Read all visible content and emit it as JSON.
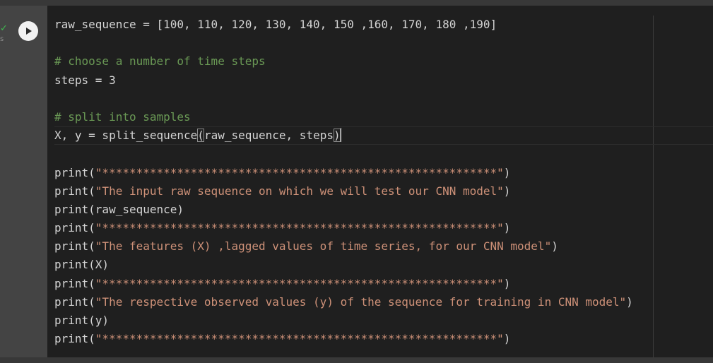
{
  "cell": {
    "run_button_label": "Run cell",
    "status": "✓",
    "status_text": "s"
  },
  "code_lines": [
    "raw_sequence = [100, 110, 120, 130, 140, 150 ,160, 170, 180 ,190]",
    "",
    "# choose a number of time steps",
    "steps = 3",
    "",
    "# split into samples",
    "X, y = split_sequence(raw_sequence, steps)",
    "",
    "print(\"**********************************************************\")",
    "print(\"The input raw sequence on which we will test our CNN model\")",
    "print(raw_sequence)",
    "print(\"**********************************************************\")",
    "print(\"The features (X) ,lagged values of time series, for our CNN model\")",
    "print(X)",
    "print(\"**********************************************************\")",
    "print(\"The respective observed values (y) of the sequence for training in CNN model\")",
    "print(y)",
    "print(\"**********************************************************\")"
  ],
  "colors": {
    "comment": "#6a9955",
    "string": "#ce9178",
    "text": "#d4d4d4",
    "editor_bg": "#1f1f1f",
    "gutter_bg": "#444444"
  }
}
